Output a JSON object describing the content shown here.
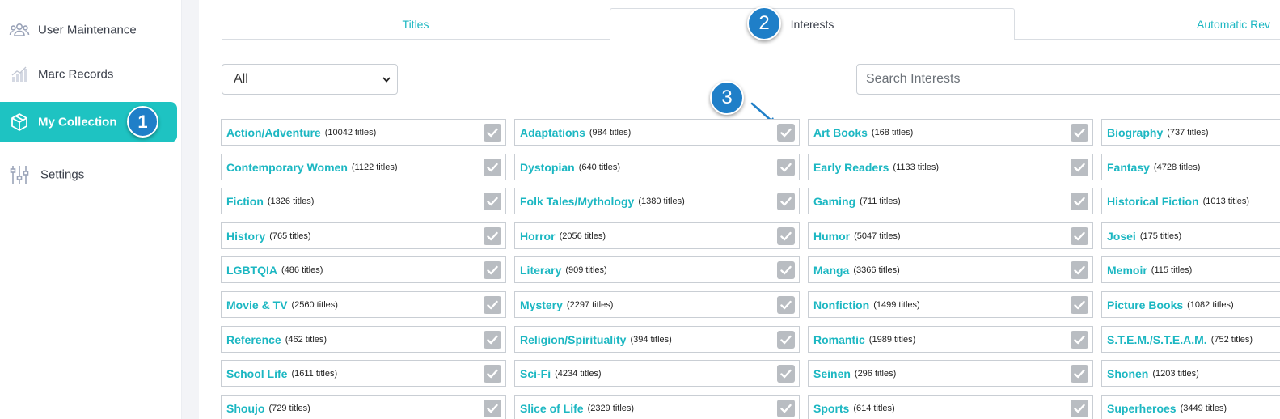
{
  "sidebar": {
    "items": [
      {
        "label": "User Maintenance",
        "icon": "users-icon"
      },
      {
        "label": "Marc Records",
        "icon": "bar-chart-icon"
      },
      {
        "label": "My Collection",
        "icon": "box-icon",
        "active": true,
        "badge": "1"
      },
      {
        "label": "Settings",
        "icon": "sliders-icon"
      }
    ]
  },
  "tabs": [
    {
      "label": "Titles"
    },
    {
      "label": "Interests",
      "active": true,
      "badge": "2"
    },
    {
      "label": "Automatic Rev"
    }
  ],
  "filter": {
    "selected": "All"
  },
  "search": {
    "placeholder": "Search Interests"
  },
  "callout": {
    "badge": "3"
  },
  "colors": {
    "accent": "#1ec3c2",
    "link": "#1cb7c2",
    "badge": "#1f7fc8",
    "check": "#b9bdc2"
  },
  "interests": [
    [
      {
        "name": "Action/Adventure",
        "count": "(10042 titles)"
      },
      {
        "name": "Adaptations",
        "count": "(984 titles)"
      },
      {
        "name": "Art Books",
        "count": "(168 titles)"
      },
      {
        "name": "Biography",
        "count": "(737 titles)"
      }
    ],
    [
      {
        "name": "Contemporary Women",
        "count": "(1122 titles)"
      },
      {
        "name": "Dystopian",
        "count": "(640 titles)"
      },
      {
        "name": "Early Readers",
        "count": "(1133 titles)"
      },
      {
        "name": "Fantasy",
        "count": "(4728 titles)"
      }
    ],
    [
      {
        "name": "Fiction",
        "count": "(1326 titles)"
      },
      {
        "name": "Folk Tales/Mythology",
        "count": "(1380 titles)"
      },
      {
        "name": "Gaming",
        "count": "(711 titles)"
      },
      {
        "name": "Historical Fiction",
        "count": "(1013 titles)"
      }
    ],
    [
      {
        "name": "History",
        "count": "(765 titles)"
      },
      {
        "name": "Horror",
        "count": "(2056 titles)"
      },
      {
        "name": "Humor",
        "count": "(5047 titles)"
      },
      {
        "name": "Josei",
        "count": "(175 titles)"
      }
    ],
    [
      {
        "name": "LGBTQIA",
        "count": "(486 titles)"
      },
      {
        "name": "Literary",
        "count": "(909 titles)"
      },
      {
        "name": "Manga",
        "count": "(3366 titles)"
      },
      {
        "name": "Memoir",
        "count": "(115 titles)"
      }
    ],
    [
      {
        "name": "Movie & TV",
        "count": "(2560 titles)"
      },
      {
        "name": "Mystery",
        "count": "(2297 titles)"
      },
      {
        "name": "Nonfiction",
        "count": "(1499 titles)"
      },
      {
        "name": "Picture Books",
        "count": "(1082 titles)"
      }
    ],
    [
      {
        "name": "Reference",
        "count": "(462 titles)"
      },
      {
        "name": "Religion/Spirituality",
        "count": "(394 titles)"
      },
      {
        "name": "Romantic",
        "count": "(1989 titles)"
      },
      {
        "name": "S.T.E.M./S.T.E.A.M.",
        "count": "(752 titles)"
      }
    ],
    [
      {
        "name": "School Life",
        "count": "(1611 titles)"
      },
      {
        "name": "Sci-Fi",
        "count": "(4234 titles)"
      },
      {
        "name": "Seinen",
        "count": "(296 titles)"
      },
      {
        "name": "Shonen",
        "count": "(1203 titles)"
      }
    ],
    [
      {
        "name": "Shoujo",
        "count": "(729 titles)"
      },
      {
        "name": "Slice of Life",
        "count": "(2329 titles)"
      },
      {
        "name": "Sports",
        "count": "(614 titles)"
      },
      {
        "name": "Superheroes",
        "count": "(3449 titles)"
      }
    ]
  ]
}
